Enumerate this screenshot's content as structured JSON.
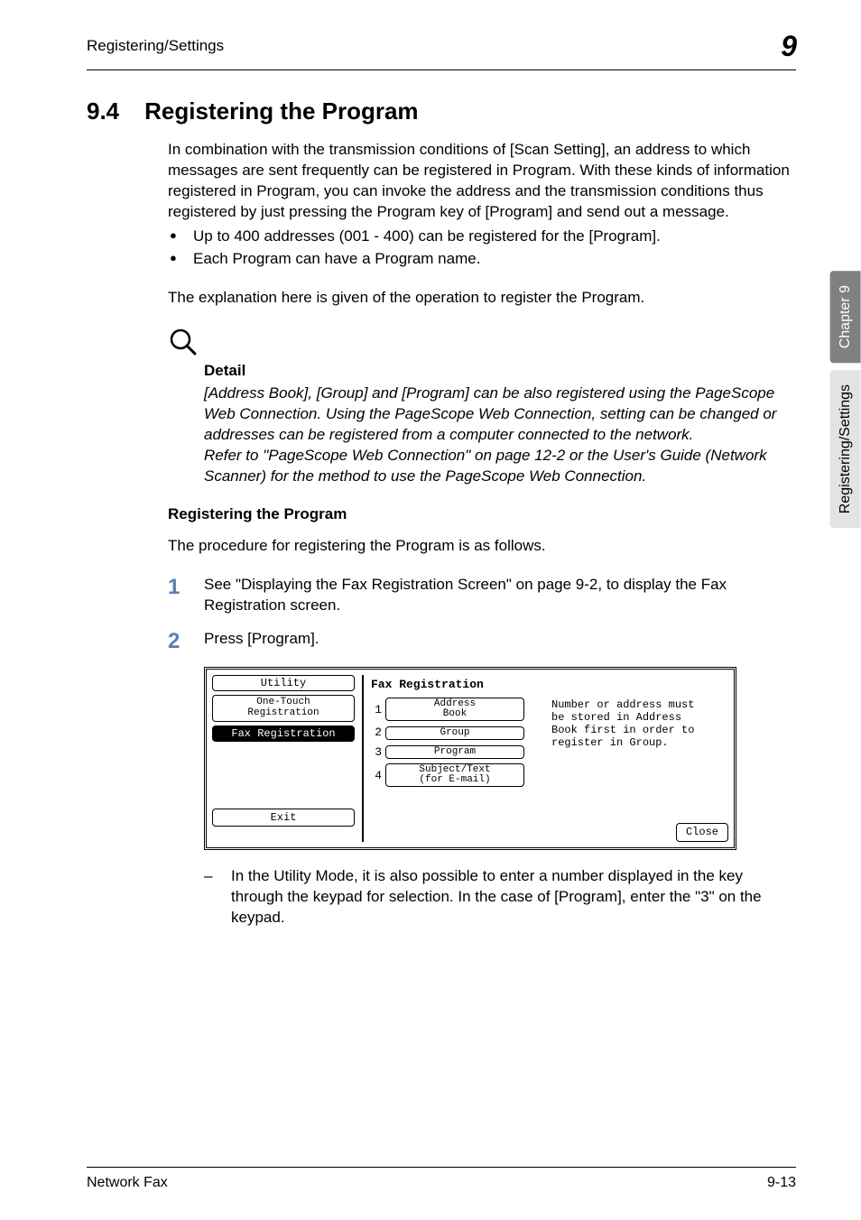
{
  "header": {
    "left": "Registering/Settings",
    "right": "9"
  },
  "section": {
    "number": "9.4",
    "title": "Registering the Program"
  },
  "intro": "In combination with the transmission conditions of [Scan Setting], an address to which messages are sent frequently can be registered in Program. With these kinds of information registered in Program, you can invoke the address and the transmission conditions thus registered by just pressing the Program key of [Program] and send out a message.",
  "bullets": [
    "Up to 400 addresses (001 - 400) can be registered for the [Program].",
    "Each Program can have a Program name."
  ],
  "explain": "The explanation here is given of the operation to register the Program.",
  "detail": {
    "label": "Detail",
    "text1": "[Address Book], [Group] and [Program] can be also registered using the PageScope Web Connection. Using the PageScope Web Connection, setting can be changed or addresses can be registered from a computer connected to the network.",
    "text2": "Refer to \"PageScope Web Connection\" on page 12-2 or the User's Guide (Network Scanner) for the method to use the PageScope Web Connection."
  },
  "sub_heading": "Registering the Program",
  "procedure_intro": "The procedure for registering the Program is as follows.",
  "steps": {
    "s1": "See \"Displaying the Fax Registration Screen\" on page 9-2, to display the Fax Registration screen.",
    "s2": "Press [Program]."
  },
  "screen": {
    "left": {
      "utility": "Utility",
      "one_touch": "One-Touch\nRegistration",
      "fax_reg": "Fax Registration",
      "exit": "Exit"
    },
    "right": {
      "title": "Fax Registration",
      "items": [
        {
          "n": "1",
          "label": "Address\nBook"
        },
        {
          "n": "2",
          "label": "Group"
        },
        {
          "n": "3",
          "label": "Program"
        },
        {
          "n": "4",
          "label": "Subject/Text\n(for E-mail)"
        }
      ],
      "hint": "Number or address must be stored in Address Book first in order to register in Group.",
      "close": "Close"
    }
  },
  "sub_note": "In the Utility Mode, it is also possible to enter a number displayed in the key through the keypad for selection. In the case of [Program], enter the \"3\" on the keypad.",
  "side_tabs": {
    "dark": "Chapter 9",
    "light": "Registering/Settings"
  },
  "footer": {
    "left": "Network Fax",
    "right": "9-13"
  }
}
